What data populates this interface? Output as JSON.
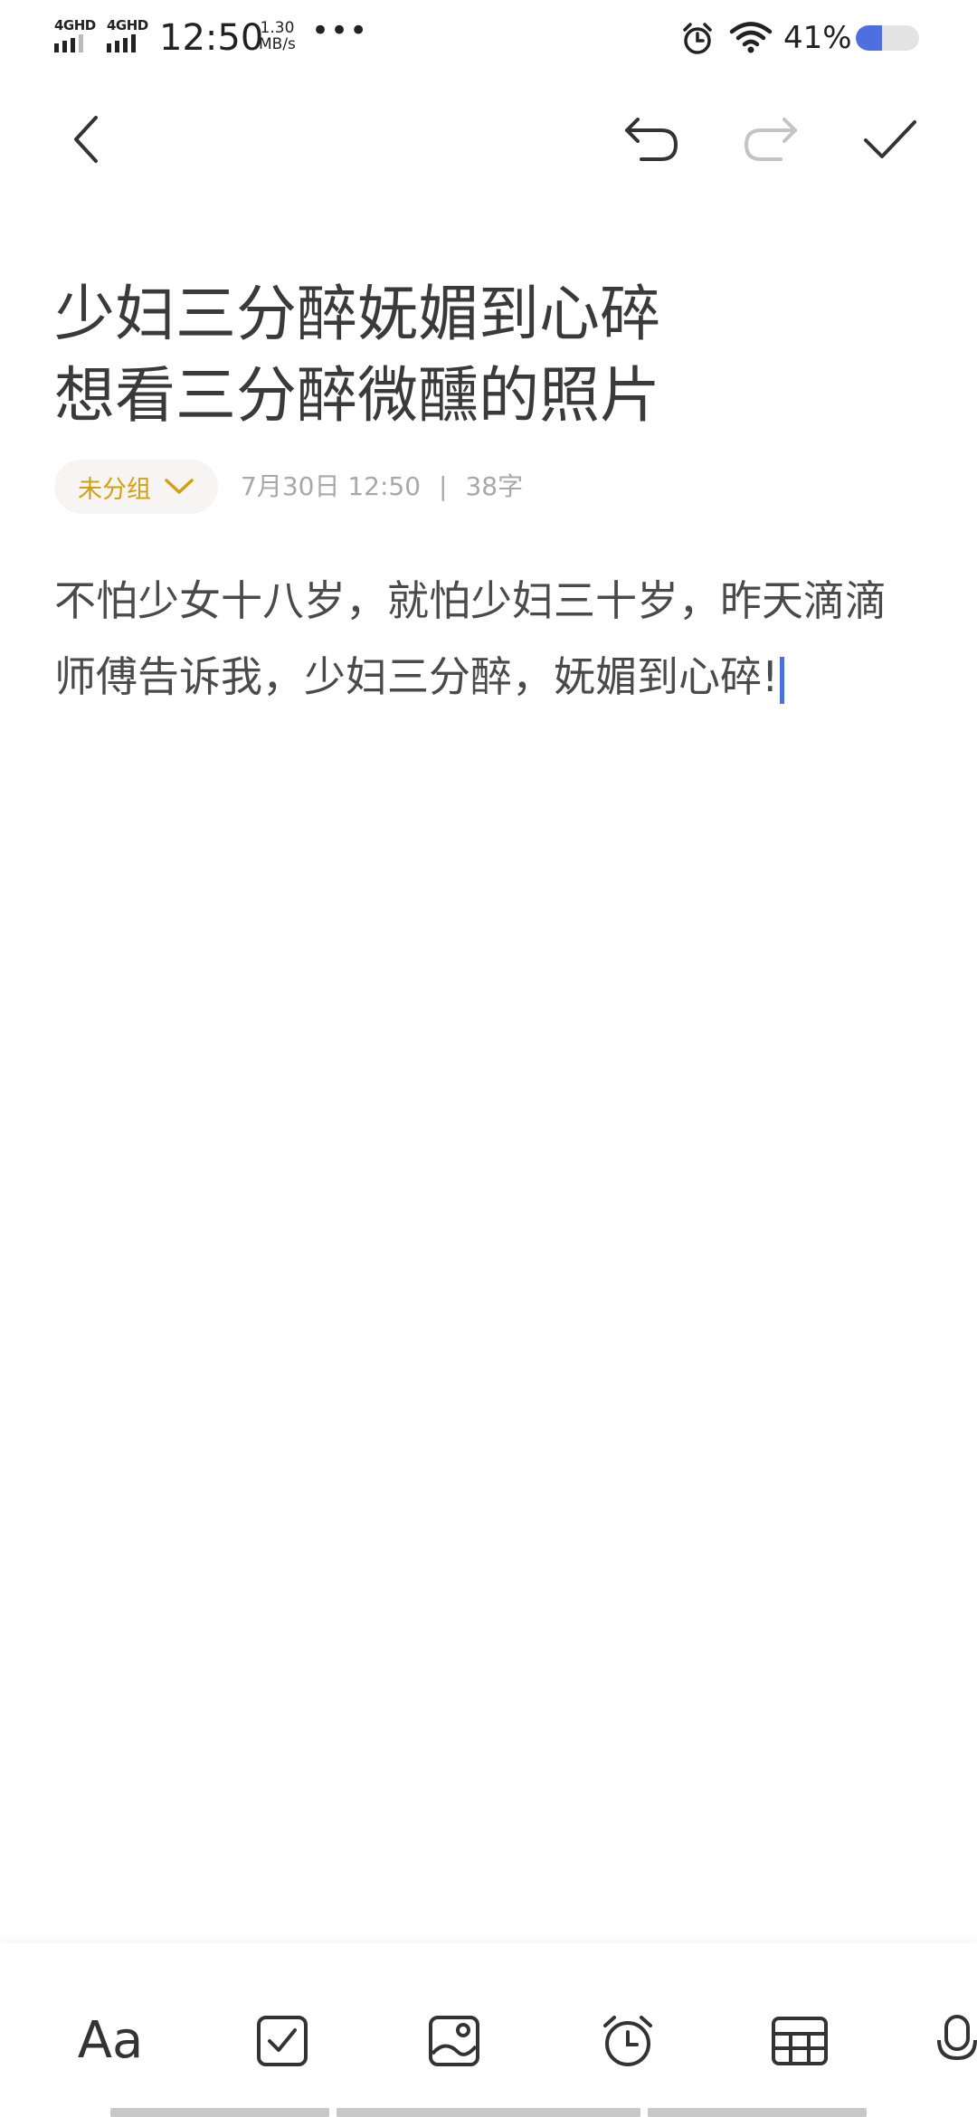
{
  "status_bar": {
    "network1": "4GHD",
    "network2": "4GHD",
    "time": "12:50",
    "speed_value": "1.30",
    "speed_unit": "MB/s",
    "more": "•••",
    "battery_text": "41%",
    "battery_level": 0.41,
    "accent_color": "#4d6fe0"
  },
  "toolbar": {
    "back_icon": "chevron-left-icon",
    "undo_icon": "undo-icon",
    "redo_icon": "redo-icon",
    "redo_enabled": false,
    "done_icon": "check-icon"
  },
  "note": {
    "title_line1": "少妇三分醉妩媚到心碎",
    "title_line2": "想看三分醉微醺的照片",
    "group_label": "未分组",
    "group_color": "#d4a012",
    "date": "7月30日 12:50",
    "separator": "|",
    "char_count": "38字",
    "body_line1": "不怕少女十八岁，就怕少妇三十岁，昨天滴滴",
    "body_line2": "师傅告诉我，少妇三分醉，妩媚到心碎!"
  },
  "bottom_toolbar": {
    "items": [
      {
        "name": "text-format",
        "label": "Aa"
      },
      {
        "name": "checklist-icon"
      },
      {
        "name": "image-icon"
      },
      {
        "name": "alarm-icon"
      },
      {
        "name": "table-icon"
      },
      {
        "name": "microphone-icon"
      }
    ]
  }
}
